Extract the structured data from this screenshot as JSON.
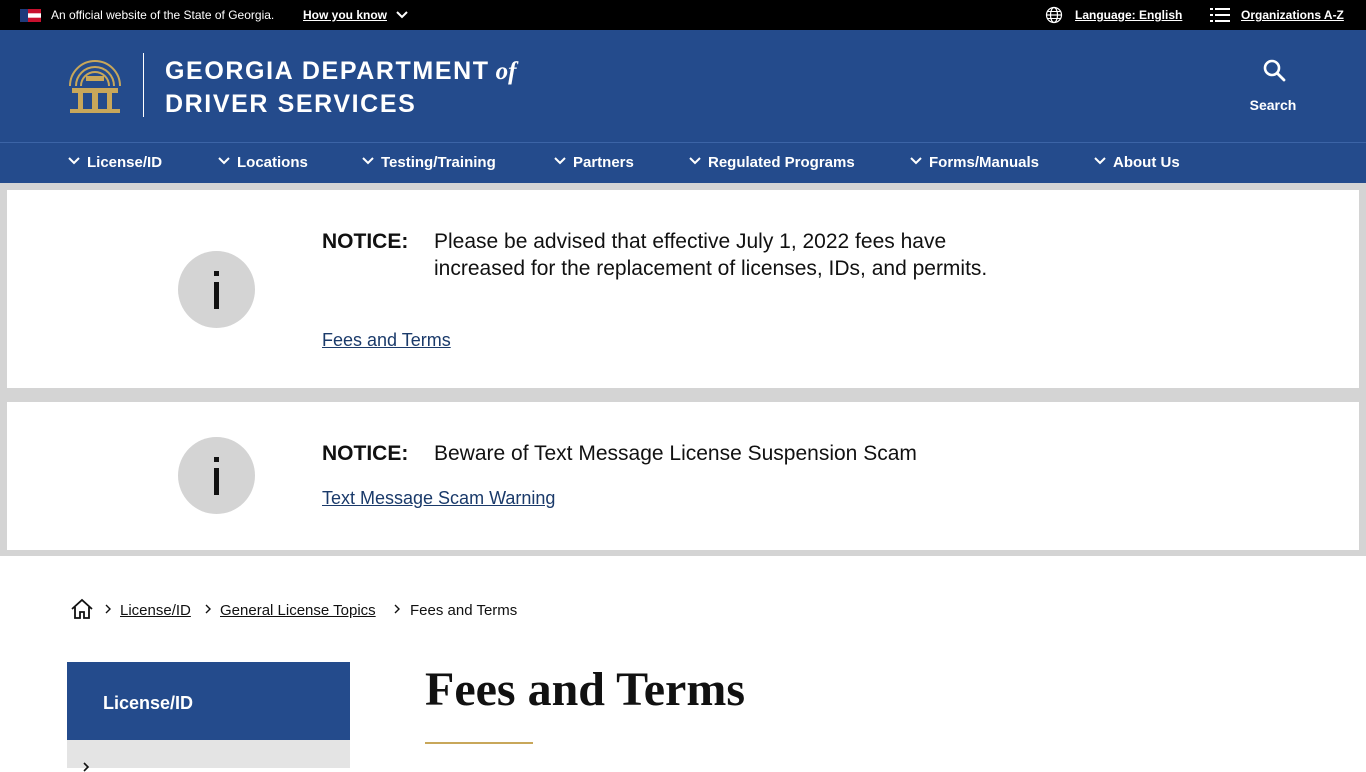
{
  "topbar": {
    "official_text": "An official website of the State of Georgia.",
    "how_you_know": "How you know",
    "language": "Language: English",
    "organizations": "Organizations A-Z"
  },
  "header": {
    "agency_line1": "GEORGIA DEPARTMENT",
    "agency_of": "of",
    "agency_line2": "DRIVER SERVICES",
    "search_label": "Search"
  },
  "nav": {
    "items": [
      {
        "label": "License/ID"
      },
      {
        "label": "Locations"
      },
      {
        "label": "Testing/Training"
      },
      {
        "label": "Partners"
      },
      {
        "label": "Regulated Programs"
      },
      {
        "label": "Forms/Manuals"
      },
      {
        "label": "About Us"
      }
    ]
  },
  "notices": [
    {
      "label": "NOTICE:",
      "text": "Please be advised that effective July 1, 2022 fees have increased for the replacement of licenses, IDs, and permits.",
      "link": "Fees and Terms"
    },
    {
      "label": "NOTICE:",
      "text": "Beware of Text Message License Suspension Scam",
      "link": "Text Message Scam Warning"
    }
  ],
  "breadcrumb": {
    "items": [
      "License/ID",
      "General License Topics",
      "Fees and Terms"
    ]
  },
  "sidebar": {
    "heading": "License/ID"
  },
  "page": {
    "title": "Fees and Terms"
  },
  "colors": {
    "brand_blue": "#244b8c",
    "gold": "#c8a75a",
    "notice_gray": "#d4d4d4"
  }
}
